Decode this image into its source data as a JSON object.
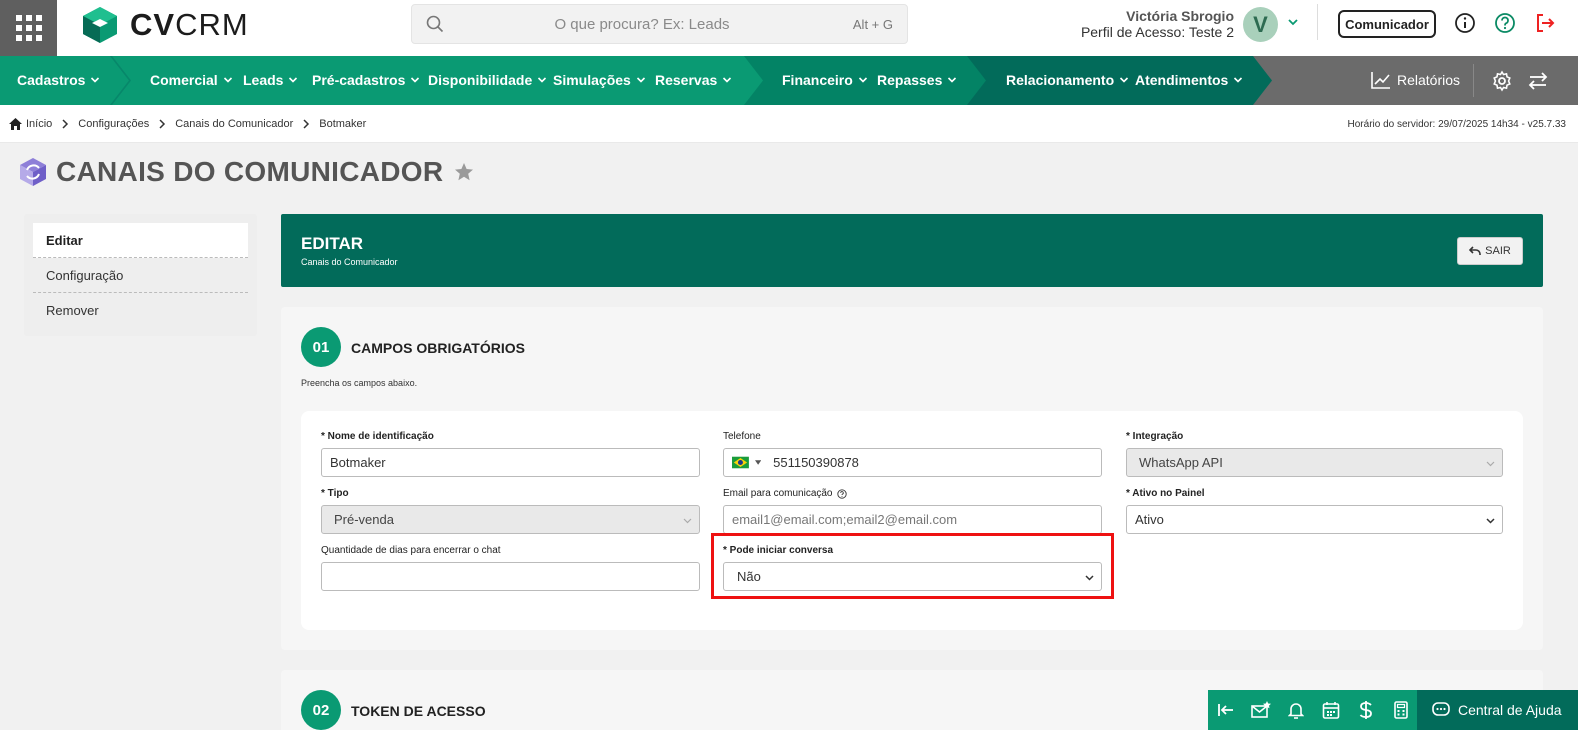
{
  "topbar": {
    "logo_bold": "CV",
    "logo_light": "CRM",
    "search_placeholder": "O que procura? Ex: Leads",
    "search_shortcut": "Alt + G",
    "user_name": "Victória Sbrogio",
    "user_profile": "Perfil de Acesso: Teste 2",
    "avatar_initial": "V",
    "communicator_label": "Comunicador"
  },
  "nav": {
    "items": [
      {
        "label": "Cadastros"
      },
      {
        "label": "Comercial"
      },
      {
        "label": "Leads"
      },
      {
        "label": "Pré-cadastros"
      },
      {
        "label": "Disponibilidade"
      },
      {
        "label": "Simulações"
      },
      {
        "label": "Reservas"
      },
      {
        "label": "Financeiro"
      },
      {
        "label": "Repasses"
      },
      {
        "label": "Relacionamento"
      },
      {
        "label": "Atendimentos"
      }
    ],
    "reports_label": "Relatórios",
    "colors": {
      "cadastros": "#0a9a73",
      "comercial": "#0a9a73",
      "financeiro": "#038365",
      "relacionamento": "#026b5a",
      "tools": "#6b6b6b"
    }
  },
  "breadcrumb": {
    "items": [
      "Início",
      "Configurações",
      "Canais do Comunicador",
      "Botmaker"
    ],
    "server_time": "Horário do servidor: 29/07/2025 14h34 - v25.7.33"
  },
  "page": {
    "title": "CANAIS DO COMUNICADOR"
  },
  "sidemenu": {
    "items": [
      {
        "label": "Editar",
        "active": true
      },
      {
        "label": "Configuração"
      },
      {
        "label": "Remover"
      }
    ]
  },
  "edit_header": {
    "title": "EDITAR",
    "subtitle": "Canais do Comunicador",
    "exit_label": "SAIR"
  },
  "section1": {
    "number": "01",
    "title": "CAMPOS OBRIGATÓRIOS",
    "description": "Preencha os campos abaixo.",
    "fields": {
      "nome": {
        "label": "* Nome de identificação",
        "value": "Botmaker"
      },
      "telefone": {
        "label": "Telefone",
        "value": "551150390878"
      },
      "integracao": {
        "label": "* Integração",
        "value": "WhatsApp API"
      },
      "tipo": {
        "label": "* Tipo",
        "value": "Pré-venda"
      },
      "email": {
        "label": "Email para comunicação",
        "placeholder": "email1@email.com;email2@email.com"
      },
      "ativo": {
        "label": "* Ativo no Painel",
        "value": "Ativo"
      },
      "dias": {
        "label": "Quantidade de dias para encerrar o chat",
        "value": ""
      },
      "iniciar": {
        "label": "* Pode iniciar conversa",
        "value": "Não"
      }
    }
  },
  "section2": {
    "number": "02",
    "title": "TOKEN DE ACESSO"
  },
  "bottom_bar": {
    "help_label": "Central de Ajuda"
  }
}
